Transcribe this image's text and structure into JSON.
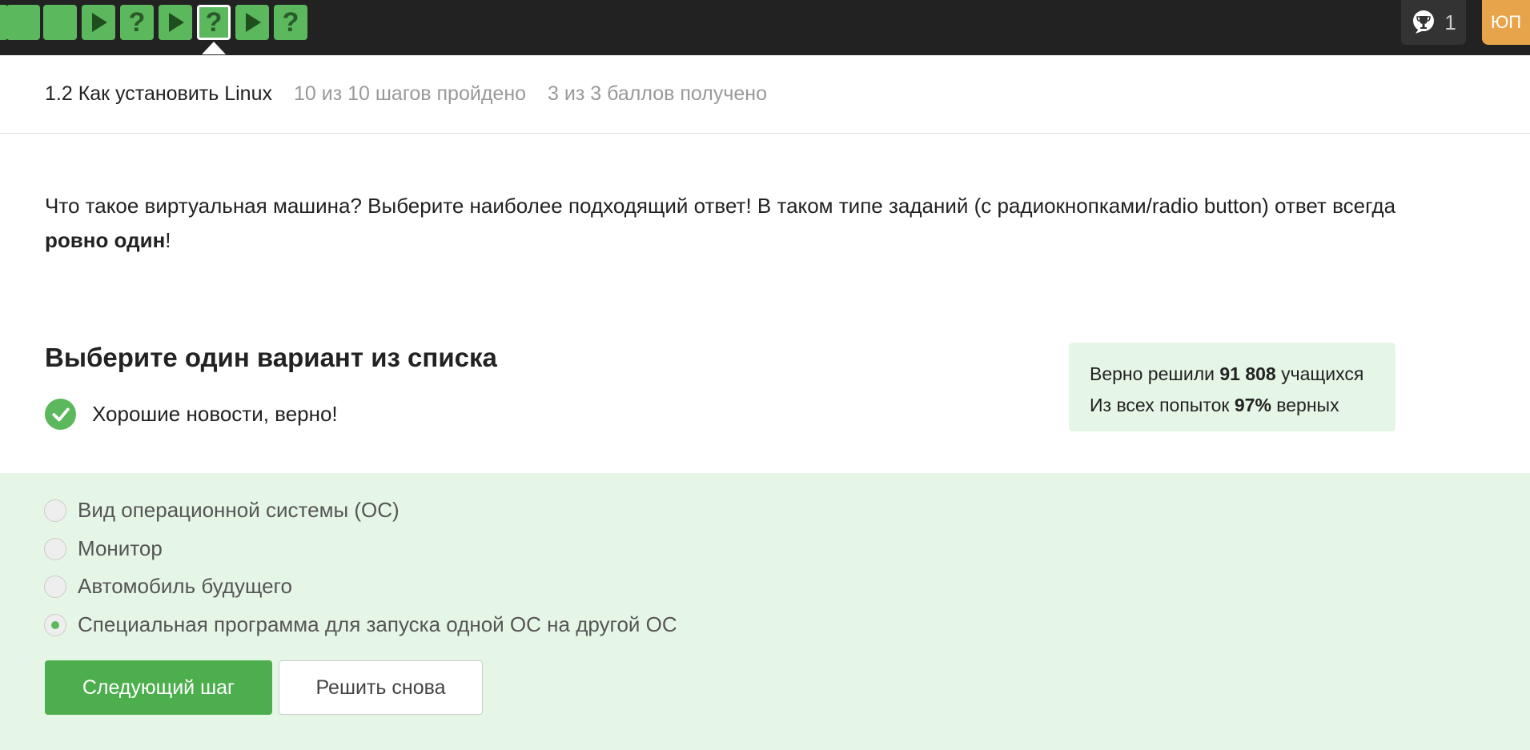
{
  "nav": {
    "steps": [
      {
        "type": "text",
        "status": "passed"
      },
      {
        "type": "text",
        "status": "passed"
      },
      {
        "type": "video",
        "status": "passed"
      },
      {
        "type": "quiz",
        "status": "passed"
      },
      {
        "type": "video",
        "status": "passed"
      },
      {
        "type": "quiz",
        "status": "passed",
        "current": true
      },
      {
        "type": "video",
        "status": "passed"
      },
      {
        "type": "quiz",
        "status": "passed"
      }
    ],
    "step_icons": {
      "video": "play-icon",
      "quiz": "question-mark-icon",
      "text": "blank"
    },
    "quiz_glyph": "?",
    "trophy_count": "1",
    "avatar_initials": "ЮП"
  },
  "lesson": {
    "title": "1.2 Как установить Linux",
    "steps_progress": "10 из 10 шагов пройдено",
    "score_progress": "3 из 3 баллов  получено"
  },
  "question": {
    "text_before": "Что такое виртуальная машина? Выберите наиболее подходящий ответ! В таком типе заданий (с радиокнопками/radio button) ответ всегда ",
    "text_bold": "ровно один",
    "text_after": "!"
  },
  "quiz": {
    "title": "Выберите один вариант из списка",
    "feedback": "Хорошие новости, верно!",
    "options": [
      {
        "label": "Вид операционной системы (ОС)",
        "checked": false
      },
      {
        "label": "Монитор",
        "checked": false
      },
      {
        "label": "Автомобиль будущего",
        "checked": false
      },
      {
        "label": "Специальная программа для запуска одной ОС на другой ОС",
        "checked": true
      }
    ],
    "next_button": "Следующий шаг",
    "retry_button": "Решить снова"
  },
  "stats": {
    "solved_prefix": "Верно решили ",
    "solved_count": "91 808",
    "solved_suffix": " учащихся",
    "attempts_prefix": "Из всех попыток ",
    "attempts_percent": "97%",
    "attempts_suffix": " верных"
  },
  "colors": {
    "accent": "#5cb85c",
    "topbar": "#222222",
    "avatar": "#e8a44a",
    "options_bg": "#e6f6e6"
  }
}
